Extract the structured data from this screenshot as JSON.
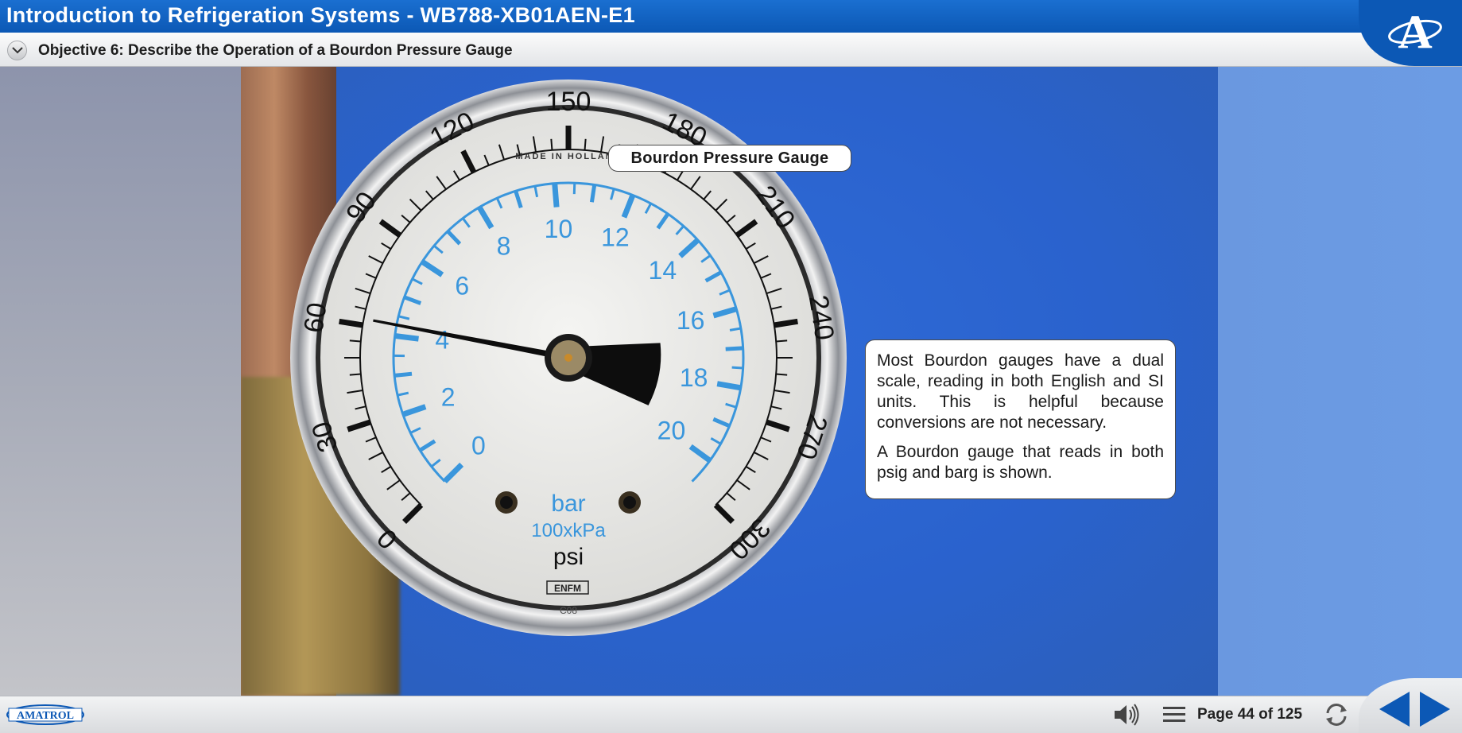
{
  "header": {
    "title": "Introduction to Refrigeration Systems - WB788-XB01AEN-E1",
    "objective": "Objective 6: Describe the Operation of a Bourdon Pressure Gauge",
    "brand_letter": "A"
  },
  "content": {
    "image_label": "Bourdon Pressure Gauge",
    "paragraphs": [
      "Most Bourdon gauges have a dual scale, reading in both English and SI units. This is helpful because conversions are not necessary.",
      "A Bourdon gauge that reads in both psig and barg is shown."
    ]
  },
  "gauge": {
    "maker_text": "MADE IN HOLLAND",
    "psi_ticks": [
      "0",
      "30",
      "60",
      "90",
      "120",
      "150",
      "180",
      "210",
      "240",
      "270",
      "300"
    ],
    "bar_ticks": [
      "0",
      "2",
      "4",
      "6",
      "8",
      "10",
      "12",
      "14",
      "16",
      "18",
      "20"
    ],
    "unit_bar": "bar",
    "unit_kpa": "100xkPa",
    "unit_psi": "psi",
    "brand": "ENFM",
    "code": "C08",
    "pointer_psi": 62
  },
  "footer": {
    "company": "AMATROL",
    "page_text": "Page 44 of 125",
    "current_page": 44,
    "total_pages": 125
  },
  "colors": {
    "brand_blue": "#0c58b5",
    "bar_scale_blue": "#3a96dc"
  }
}
